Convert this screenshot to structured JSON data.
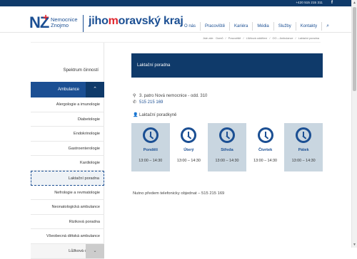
{
  "topbar": {
    "phone": "+420 515 215 311",
    "social_icon": "facebook-icon",
    "social_glyph": "f"
  },
  "logo": {
    "mark": "NZ",
    "plus": "+",
    "line1": "Nemocnice",
    "line2": "Znojmo"
  },
  "region": {
    "before": "jiho",
    "accent": "m",
    "after": "oravský kraj"
  },
  "nav": {
    "items": [
      "O nás",
      "Pracoviště",
      "Kariéra",
      "Média",
      "Služby",
      "Kontakty"
    ],
    "search_icon": "search-icon",
    "search_glyph": "⌕"
  },
  "breadcrumb": [
    "Jste zde:",
    "Domů",
    "/",
    "Pracoviště",
    "/",
    "Lůžková oddělení",
    "/",
    "OO – Ambulance",
    "/",
    "Laktační poradna"
  ],
  "sidebar": {
    "heading": "Spektrum činností",
    "section": "Ambulance",
    "section_toggle": "⌃",
    "items": [
      "Alergologie a imunologie",
      "Diabetologie",
      "Endokrinologie",
      "Gastroenterologie",
      "Kardiologie",
      "Laktační poradna",
      "Nefrologie a revmatologie",
      "Neonatologická ambulance",
      "Riziková poradna",
      "Všeobecná dětská ambulance",
      "Lůžková oddělení"
    ],
    "active_index": 5,
    "last_toggle": "⌄"
  },
  "main": {
    "title": "Laktační poradna",
    "address": "3. patro Nová nemocnice - odd. 310",
    "address_icon": "map-marker-icon",
    "phone": "515 215 169",
    "phone_icon": "phone-icon",
    "doctor_label": "Laktační poradkyně",
    "doctor_icon": "user-icon",
    "days": [
      {
        "name": "Pondělí",
        "time": "13:00 – 14:30",
        "shaded": true
      },
      {
        "name": "Úterý",
        "time": "13:00 – 14:30",
        "shaded": false
      },
      {
        "name": "Středa",
        "time": "13:00 – 14:30",
        "shaded": true
      },
      {
        "name": "Čtvrtek",
        "time": "13:00 – 14:30",
        "shaded": false
      },
      {
        "name": "Pátek",
        "time": "13:00 – 14:30",
        "shaded": true
      }
    ],
    "note": "Nutno předem telefonicky objednat – 515 215 169"
  },
  "colors": {
    "brand": "#1b4f93",
    "dark": "#0f3a6a",
    "accent": "#e0262d",
    "shade": "#c9d6e0"
  }
}
